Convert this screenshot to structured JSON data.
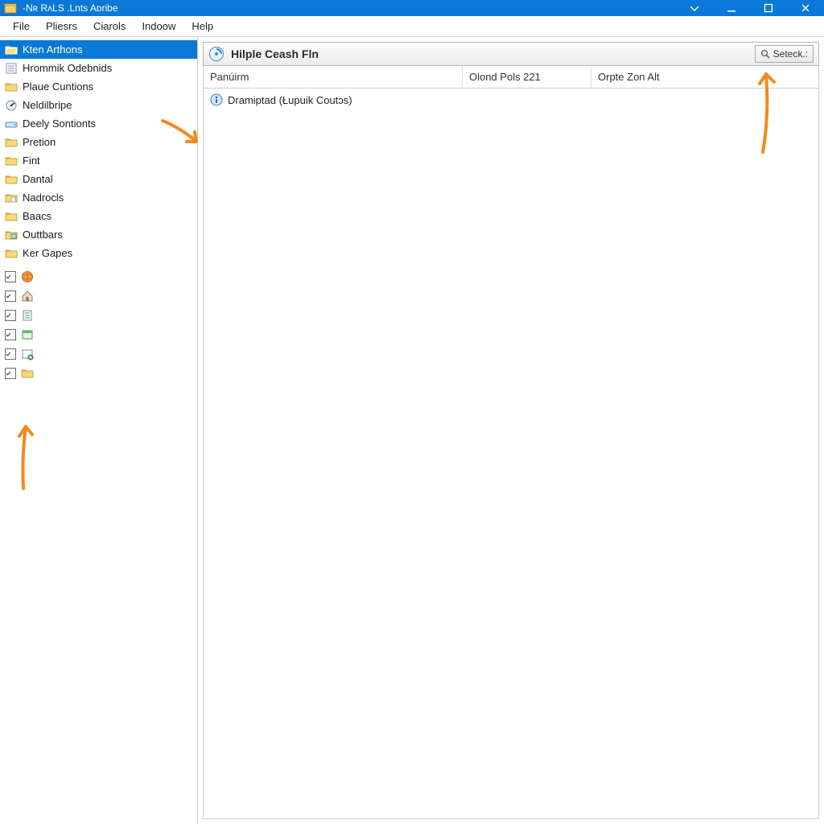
{
  "window": {
    "title": "-Nʀ RʌLS .Lnts Aᴅribe"
  },
  "menu": {
    "items": [
      "File",
      "Pliesrs",
      "Ciarols",
      "Indoow",
      "Help"
    ]
  },
  "sidebar": {
    "items": [
      {
        "label": "Kten Arthons",
        "icon": "folder-open",
        "selected": true
      },
      {
        "label": "Hrommik Odebnids",
        "icon": "form",
        "selected": false
      },
      {
        "label": "Plaue Cuntions",
        "icon": "folder",
        "selected": false
      },
      {
        "label": "Neldilbripe",
        "icon": "gauge",
        "selected": false
      },
      {
        "label": "Deely Sontionts",
        "icon": "drive",
        "selected": false
      },
      {
        "label": "Pretion",
        "icon": "folder",
        "selected": false
      },
      {
        "label": "Fint",
        "icon": "folder",
        "selected": false
      },
      {
        "label": "Dantal",
        "icon": "folder",
        "selected": false
      },
      {
        "label": "Nadrocls",
        "icon": "folder-doc",
        "selected": false
      },
      {
        "label": "Baacs",
        "icon": "folder",
        "selected": false
      },
      {
        "label": "Outtbars",
        "icon": "folder-image",
        "selected": false
      },
      {
        "label": "Ker Gapes",
        "icon": "folder",
        "selected": false
      }
    ],
    "checks": [
      {
        "checked": true,
        "icon": "globe"
      },
      {
        "checked": true,
        "icon": "house"
      },
      {
        "checked": true,
        "icon": "sheet"
      },
      {
        "checked": true,
        "icon": "window"
      },
      {
        "checked": true,
        "icon": "plug"
      },
      {
        "checked": true,
        "icon": "folder"
      }
    ]
  },
  "main": {
    "title": "Hilple Ceash Fln",
    "search_label": "Seteck.:",
    "columns": [
      "Panúirm",
      "Olond Pols 221",
      "Orpte Zon Alt"
    ],
    "rows": [
      {
        "name": "Dramiptad (Łupuik Coutɔs)",
        "c2": "",
        "c3": ""
      }
    ]
  }
}
